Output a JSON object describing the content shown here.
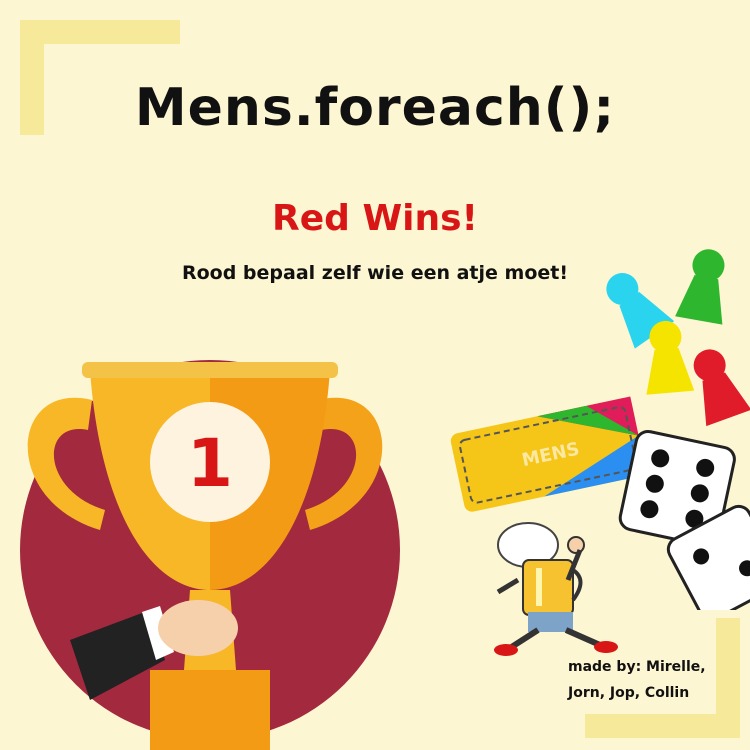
{
  "title": "Mens.foreach();",
  "result_text": "Red Wins!",
  "instruction_text": "Rood bepaal zelf wie een atje moet!",
  "trophy": {
    "rank": "1"
  },
  "board_box": {
    "logo": "MENS"
  },
  "credits": {
    "line1": "made by: Mirelle,",
    "line2": "Jorn, Jop, Collin"
  },
  "icons": [
    "trophy-icon",
    "pawn-icon",
    "dice-icon",
    "game-box-icon",
    "beer-mascot-icon"
  ],
  "colors": {
    "background": "#fdf6d2",
    "title": "#111111",
    "win_text": "#d91616",
    "circle": "#a3293f",
    "trophy_gold": "#f7b727",
    "pawn_cyan": "#2ad4ef",
    "pawn_green": "#2fb62f",
    "pawn_yellow": "#f5e400",
    "pawn_red": "#e01c2b"
  }
}
